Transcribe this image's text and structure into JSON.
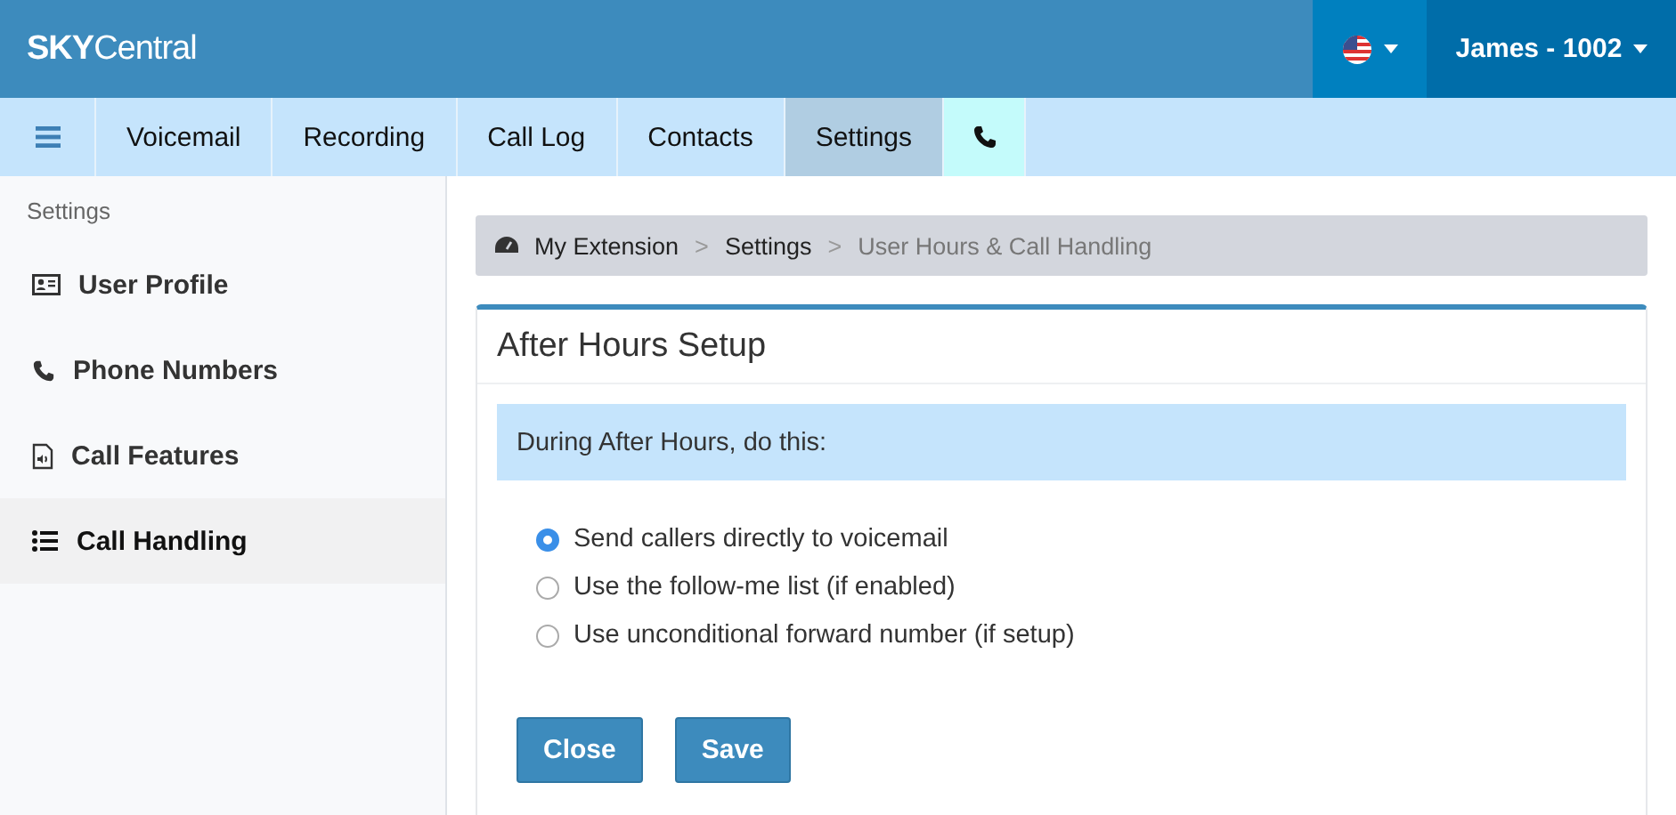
{
  "header": {
    "logo": "**SKY**Central",
    "user_menu": {
      "label": "James - 1002"
    }
  },
  "tabs": [
    {
      "kind": "menu",
      "selected": false
    },
    {
      "kind": "text",
      "label": "Voicemail",
      "selected": false
    },
    {
      "kind": "text",
      "label": "Recording",
      "selected": false
    },
    {
      "kind": "text",
      "label": "Call Log",
      "selected": false
    },
    {
      "kind": "text",
      "label": "Contacts",
      "selected": false
    },
    {
      "kind": "text",
      "label": "Settings",
      "selected": true
    },
    {
      "kind": "phone",
      "selected": false
    }
  ],
  "sidebar": {
    "heading": "Settings",
    "items": [
      {
        "kind": "profile",
        "label": "User Profile",
        "selected": false
      },
      {
        "kind": "phone",
        "label": "Phone Numbers",
        "selected": false
      },
      {
        "kind": "file",
        "label": "Call Features",
        "selected": false
      },
      {
        "kind": "list",
        "label": "Call Handling",
        "selected": true
      }
    ]
  },
  "breadcrumb": [
    {
      "label": "My Extension",
      "kind": "link"
    },
    {
      "label": "Settings",
      "kind": "link"
    },
    {
      "label": "User Hours & Call Handling",
      "kind": "current"
    }
  ],
  "breadcrumb_separator": ">",
  "panel": {
    "title": "After Hours Setup",
    "notice": "During After Hours, do this:",
    "options": [
      {
        "label": "Send callers directly to voicemail",
        "selected": true
      },
      {
        "label": "Use the follow-me list (if enabled)",
        "selected": false
      },
      {
        "label": "Use unconditional forward number (if setup)",
        "selected": false
      }
    ],
    "buttons": [
      "Close",
      "Save"
    ]
  }
}
